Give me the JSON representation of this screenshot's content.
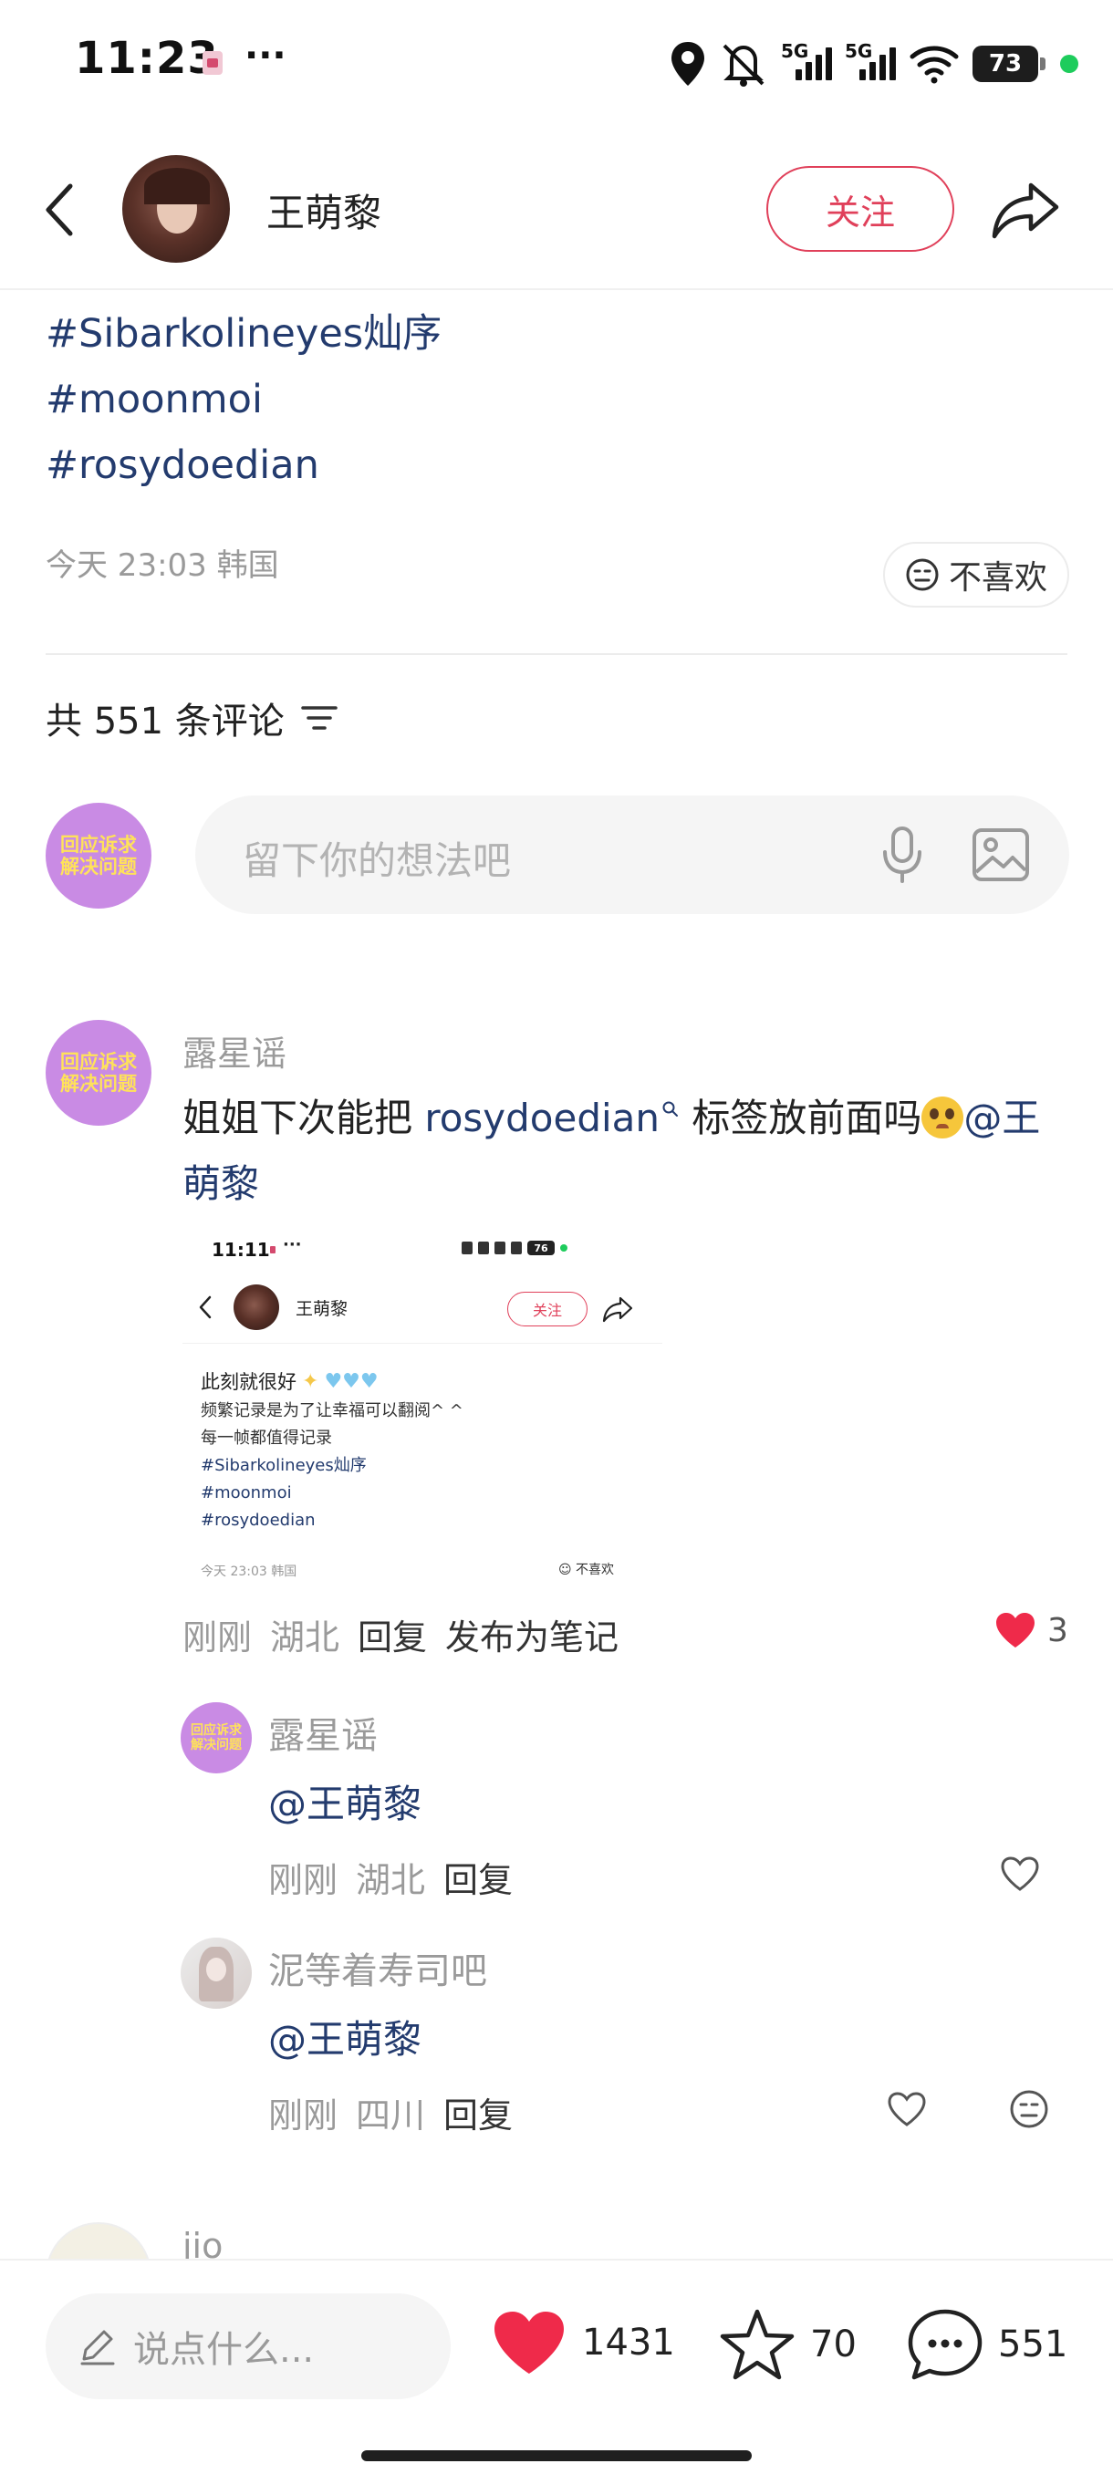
{
  "status_bar": {
    "time": "11:23",
    "dots": "···",
    "network_1": "5G",
    "network_2": "5G",
    "battery": "73",
    "icons": [
      "location-icon",
      "mute-icon",
      "signal-icon",
      "wifi-icon",
      "battery-icon"
    ]
  },
  "header": {
    "author_name": "王萌黎",
    "follow_label": "关注"
  },
  "post": {
    "tags": [
      "#Sibarkolineyes灿序",
      "#moonmoi",
      "#rosydoedian"
    ],
    "meta": "今天 23:03 韩国",
    "dislike_label": "不喜欢"
  },
  "comments_section": {
    "count_label": "共 551 条评论",
    "input_placeholder": "留下你的想法吧",
    "my_avatar_text": [
      "回应诉求",
      "解决问题"
    ]
  },
  "comment_1": {
    "author": "露星谣",
    "avatar_text": [
      "回应诉求",
      "解决问题"
    ],
    "text_before": "姐姐下次能把 ",
    "text_link": "rosydoedian",
    "text_after": " 标签放前面吗",
    "mention": "@王萌黎",
    "meta_time": "刚刚",
    "meta_location": "湖北",
    "reply_label": "回复",
    "publish_label": "发布为笔记",
    "like_count": "3",
    "screenshot": {
      "time": "11:11",
      "dots": "···",
      "battery": "76",
      "author_name": "王萌黎",
      "follow_label": "关注",
      "first_line": "此刻就很好",
      "line_2": "频繁记录是为了让幸福可以翻阅^ ^",
      "line_3": "每一帧都值得记录",
      "tags": [
        "#Sibarkolineyes灿序",
        "#moonmoi",
        "#rosydoedian"
      ],
      "meta": "今天 23:03 韩国",
      "dislike_label": "不喜欢"
    }
  },
  "reply_1": {
    "author": "露星谣",
    "avatar_text": [
      "回应诉求",
      "解决问题"
    ],
    "text": "@王萌黎",
    "meta_time": "刚刚",
    "meta_location": "湖北",
    "reply_label": "回复"
  },
  "reply_2": {
    "author": "泥等着寿司吧",
    "text": "@王萌黎",
    "meta_time": "刚刚",
    "meta_location": "四川",
    "reply_label": "回复"
  },
  "comment_3": {
    "author": "jio"
  },
  "bottom_bar": {
    "say_placeholder": "说点什么...",
    "likes": "1431",
    "stars": "70",
    "comments": "551"
  },
  "colors": {
    "accent_red": "#e0405a",
    "link_blue": "#233b6e",
    "like_red": "#ef2a4a",
    "badge_purple": "#c98be4",
    "badge_yellow": "#ffe25a"
  }
}
